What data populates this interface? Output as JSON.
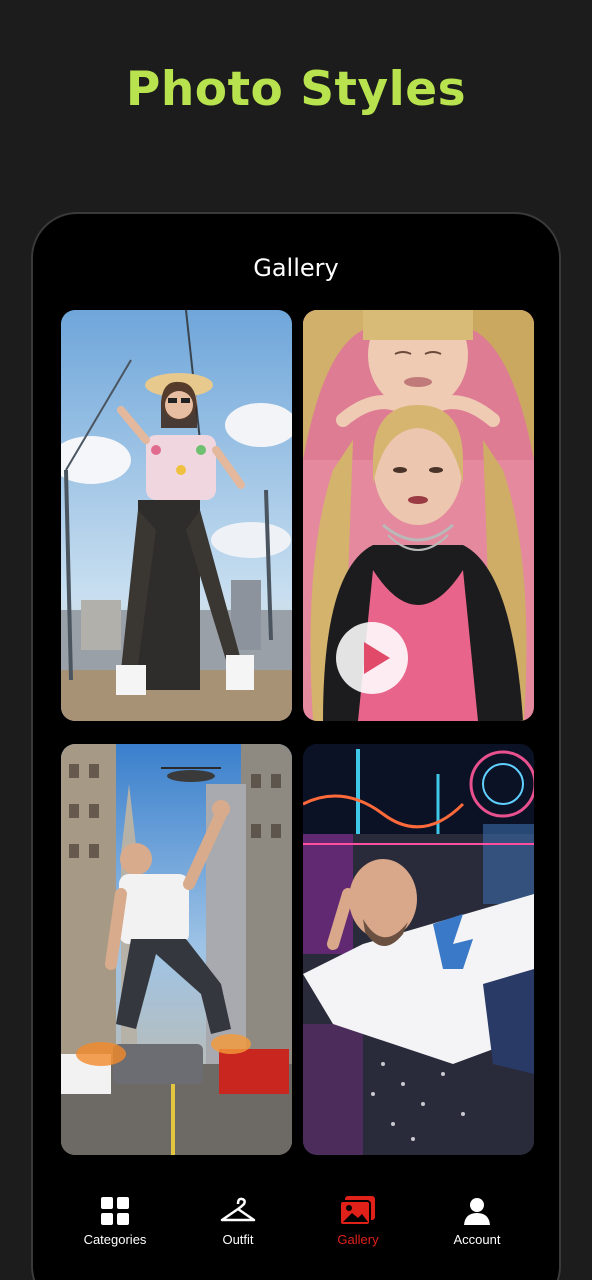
{
  "promo": {
    "title": "Photo Styles"
  },
  "screen": {
    "title": "Gallery"
  },
  "gallery": {
    "items": [
      {
        "name": "giant-construction-woman",
        "has_video": false
      },
      {
        "name": "head-holding-portrait",
        "has_video": true
      },
      {
        "name": "giant-man-city-street",
        "has_video": false
      },
      {
        "name": "man-lying-amusement-park",
        "has_video": false
      }
    ]
  },
  "tabbar": {
    "active": "Gallery",
    "active_color": "#e0211a",
    "tabs": [
      {
        "label": "Categories",
        "icon": "grid-icon"
      },
      {
        "label": "Outfit",
        "icon": "hanger-icon"
      },
      {
        "label": "Gallery",
        "icon": "gallery-icon"
      },
      {
        "label": "Account",
        "icon": "user-icon"
      }
    ]
  },
  "colors": {
    "accent": "#b8e34e",
    "background": "#1c1c1c"
  }
}
